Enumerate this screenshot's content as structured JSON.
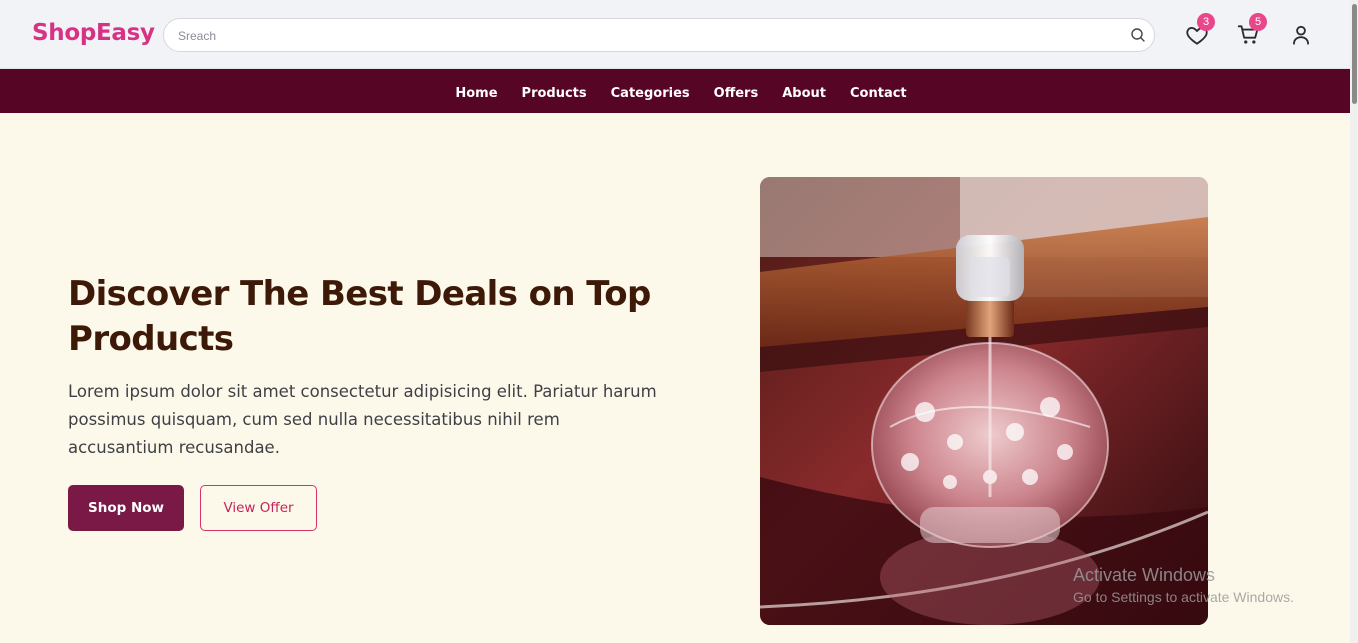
{
  "header": {
    "logo": "ShopEasy",
    "search": {
      "placeholder": "Sreach",
      "value": ""
    },
    "wishlist_count": "3",
    "cart_count": "5"
  },
  "nav": {
    "items": [
      "Home",
      "Products",
      "Categories",
      "Offers",
      "About",
      "Contact"
    ]
  },
  "hero": {
    "title": "Discover The Best Deals on Top Products",
    "text": "Lorem ipsum dolor sit amet consectetur adipisicing elit. Pariatur harum possimus quisquam, cum sed nulla necessitatibus nihil rem accusantium recusandae.",
    "primary_button": "Shop Now",
    "secondary_button": "View Offer",
    "image_icon": "perfume-bottle-photo"
  },
  "watermark": {
    "line1": "Activate Windows",
    "line2": "Go to Settings to activate Windows."
  },
  "colors": {
    "brand": "#d63384",
    "nav_background": "#560624",
    "primary_button": "#7a1846",
    "hero_background": "#fdf9ea",
    "badge": "#e8478c"
  }
}
